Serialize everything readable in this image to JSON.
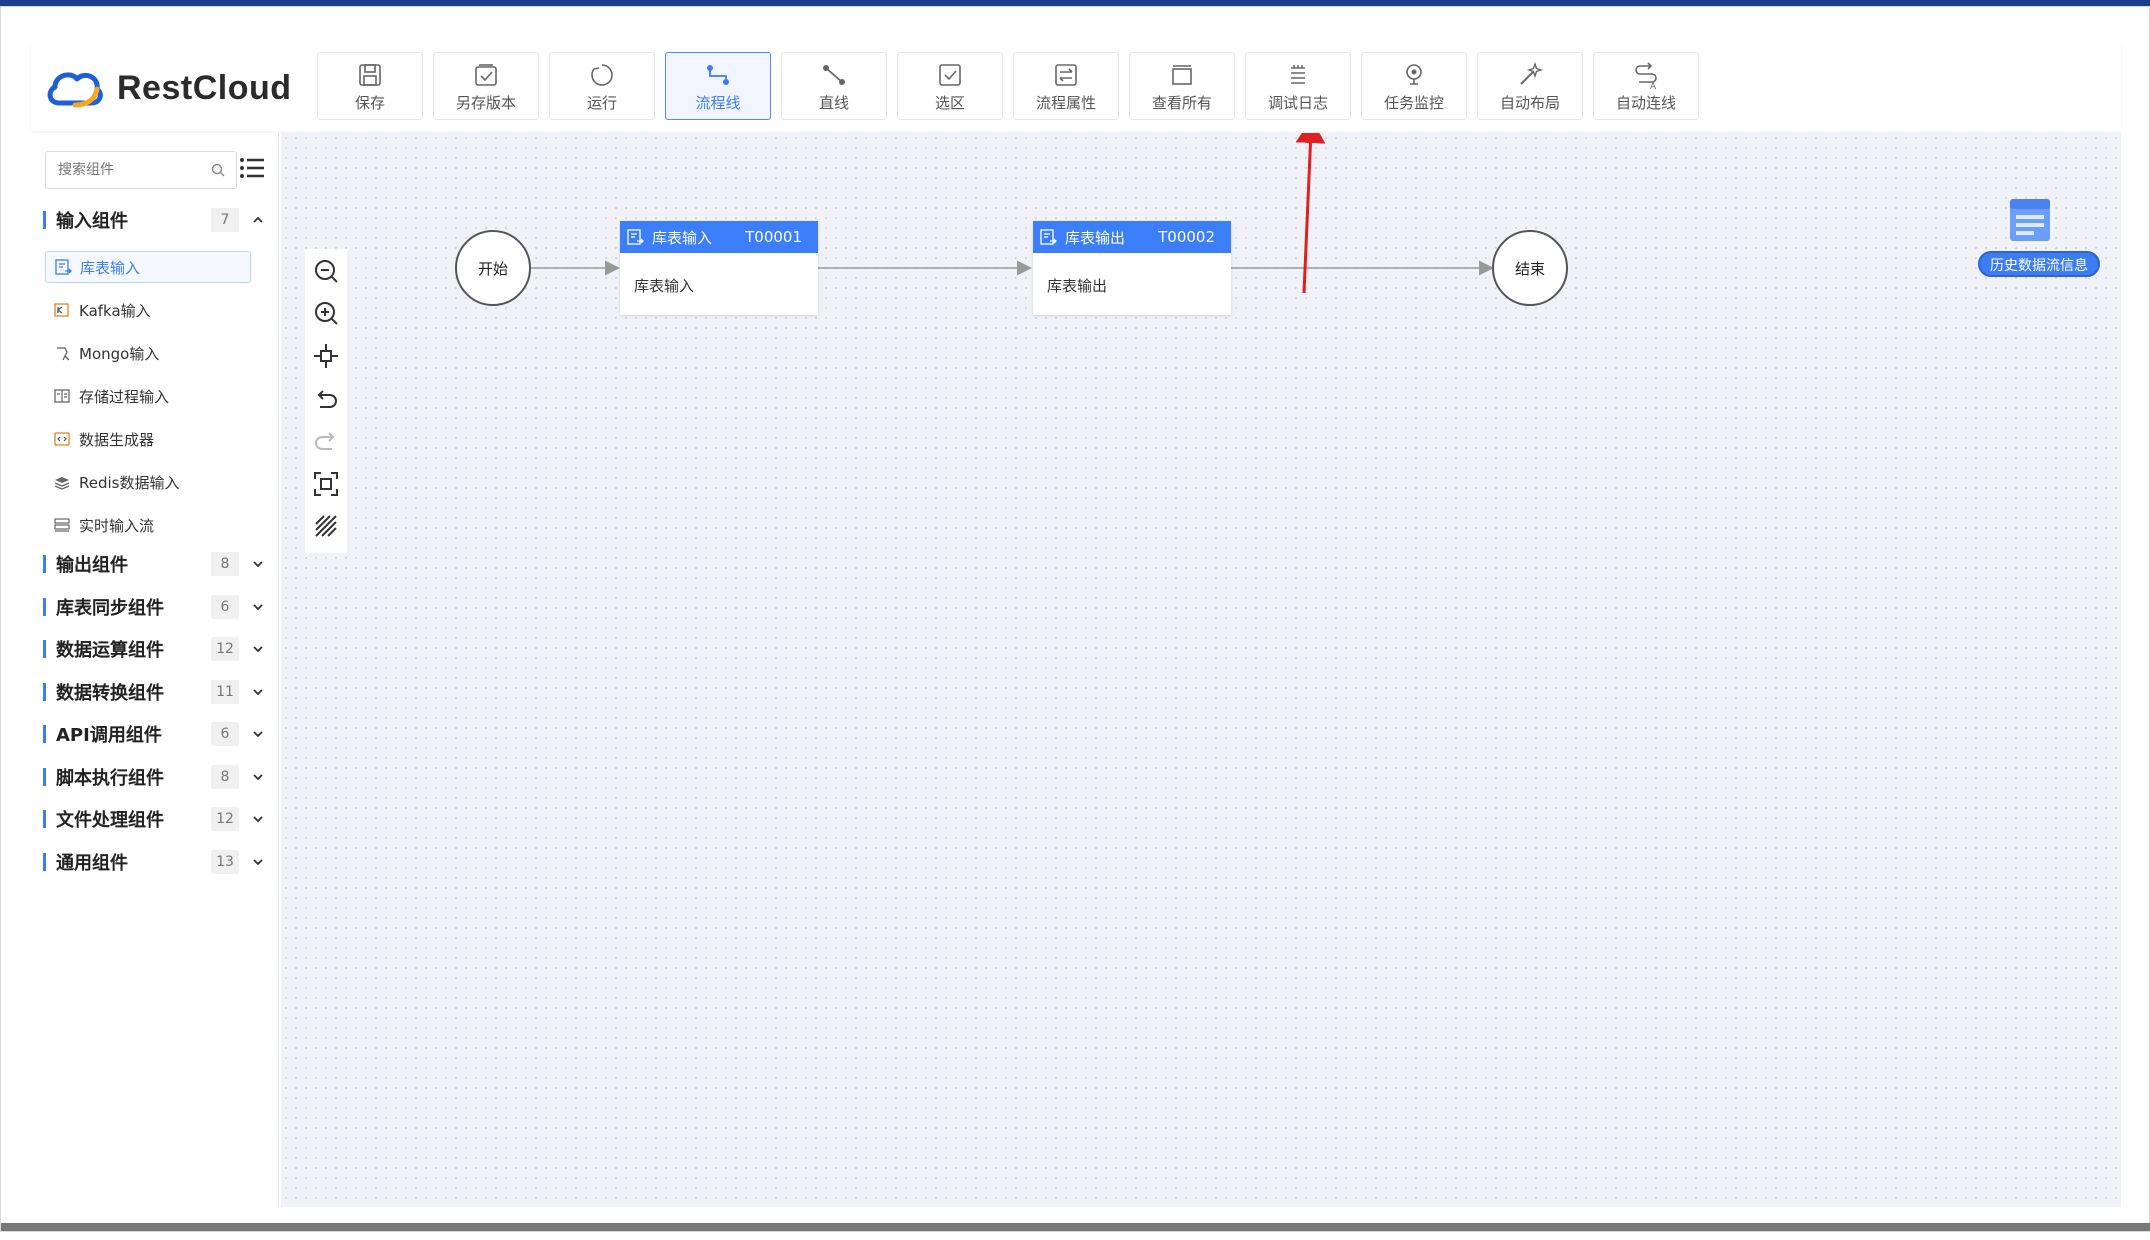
{
  "app": {
    "logo_text": "RestCloud"
  },
  "toolbar": [
    {
      "label": "保存",
      "icon": "save-icon"
    },
    {
      "label": "另存版本",
      "icon": "save-version-icon"
    },
    {
      "label": "运行",
      "icon": "run-icon"
    },
    {
      "label": "流程线",
      "icon": "flow-line-icon",
      "active": true
    },
    {
      "label": "直线",
      "icon": "straight-line-icon"
    },
    {
      "label": "选区",
      "icon": "select-area-icon"
    },
    {
      "label": "流程属性",
      "icon": "flow-properties-icon"
    },
    {
      "label": "查看所有",
      "icon": "view-all-icon"
    },
    {
      "label": "调试日志",
      "icon": "debug-log-icon"
    },
    {
      "label": "任务监控",
      "icon": "task-monitor-icon"
    },
    {
      "label": "自动布局",
      "icon": "auto-layout-icon"
    },
    {
      "label": "自动连线",
      "icon": "auto-connect-icon"
    }
  ],
  "sidebar": {
    "search_placeholder": "搜索组件",
    "groups": [
      {
        "name": "输入组件",
        "count": "7",
        "expanded": true,
        "items": [
          {
            "name": "库表输入",
            "icon": "table-input-icon",
            "selected": true
          },
          {
            "name": "Kafka输入",
            "icon": "kafka-icon"
          },
          {
            "name": "Mongo输入",
            "icon": "mongo-icon"
          },
          {
            "name": "存储过程输入",
            "icon": "procedure-icon"
          },
          {
            "name": "数据生成器",
            "icon": "generator-icon"
          },
          {
            "name": "Redis数据输入",
            "icon": "redis-icon"
          },
          {
            "name": "实时输入流",
            "icon": "stream-icon"
          }
        ]
      },
      {
        "name": "输出组件",
        "count": "8"
      },
      {
        "name": "库表同步组件",
        "count": "6"
      },
      {
        "name": "数据运算组件",
        "count": "12"
      },
      {
        "name": "数据转换组件",
        "count": "11"
      },
      {
        "name": "API调用组件",
        "count": "6"
      },
      {
        "name": "脚本执行组件",
        "count": "8"
      },
      {
        "name": "文件处理组件",
        "count": "12"
      },
      {
        "name": "通用组件",
        "count": "13"
      }
    ]
  },
  "canvas": {
    "start_label": "开始",
    "end_label": "结束",
    "nodes": [
      {
        "title": "库表输入",
        "id": "T00001",
        "body": "库表输入"
      },
      {
        "title": "库表输出",
        "id": "T00002",
        "body": "库表输出"
      }
    ],
    "history_label": "历史数据流信息"
  },
  "colors": {
    "accent": "#3b7ef8",
    "annotation_arrow": "#e02020"
  }
}
